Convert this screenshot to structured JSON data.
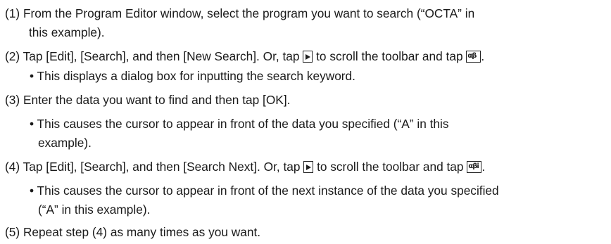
{
  "steps": [
    {
      "num": "(1)",
      "text": "From the Program Editor window, select the program you want to search (“OCTA” in",
      "cont": "this example)."
    },
    {
      "num": "(2)",
      "text_a": "Tap [Edit], [Search], and then [New Search]. Or, tap ",
      "text_b": " to scroll the toolbar and tap ",
      "text_c": ".",
      "bullet": "• This displays a dialog box for inputting the search keyword."
    },
    {
      "num": "(3)",
      "text": "Enter the data you want to find and then tap [OK].",
      "bullet": "• This causes the cursor to appear in front of the data you specified (“A” in this",
      "bullet_cont": "example)."
    },
    {
      "num": "(4)",
      "text_a": "Tap [Edit], [Search], and then [Search Next]. Or, tap ",
      "text_b": " to scroll the toolbar and tap ",
      "text_c": ".",
      "bullet": "• This causes the cursor to appear in front of the next instance of the data you specified",
      "bullet_cont": "(“A” in this example)."
    },
    {
      "num": "(5)",
      "text": "Repeat step (4) as many times as you want."
    }
  ],
  "icons": {
    "new_search_glyph": "αβ",
    "search_next_glyph": "αβi"
  }
}
